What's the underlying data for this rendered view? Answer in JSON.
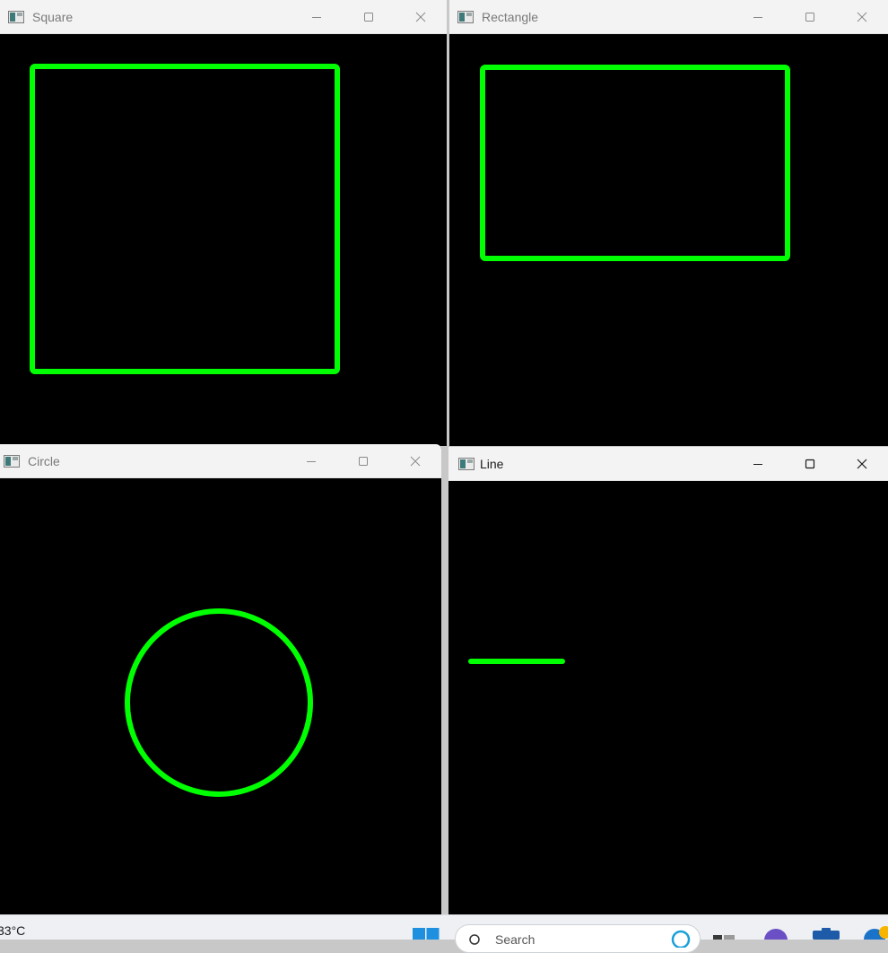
{
  "windows": [
    {
      "key": "square",
      "title": "Square",
      "active": false,
      "shape": "square"
    },
    {
      "key": "rectangle",
      "title": "Rectangle",
      "active": false,
      "shape": "rectangle"
    },
    {
      "key": "circle",
      "title": "Circle",
      "active": false,
      "shape": "circle"
    },
    {
      "key": "line",
      "title": "Line",
      "active": true,
      "shape": "line"
    }
  ],
  "shape_color": "#00ff00",
  "canvas_color": "#000000",
  "icons": {
    "app": "window-app-icon",
    "minimize": "minimize-icon",
    "maximize": "maximize-icon",
    "close": "close-icon"
  },
  "taskbar": {
    "weather_text": "33°C",
    "search_placeholder": "Search",
    "icons": [
      "windows-start-icon",
      "search-icon",
      "copilot-icon",
      "task-view-icon",
      "teams-icon",
      "store-icon",
      "edge-icon"
    ]
  }
}
